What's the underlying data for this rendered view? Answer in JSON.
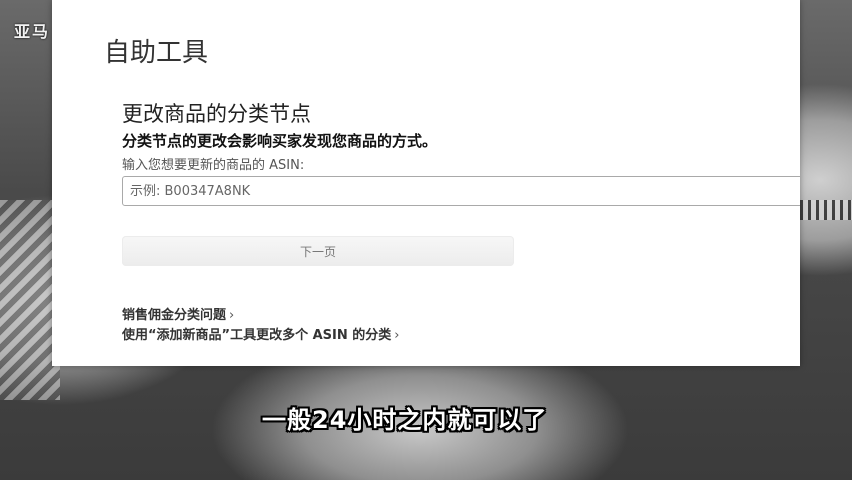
{
  "overlay": {
    "corner_label": "亚马",
    "subtitle": "一般24小时之内就可以了"
  },
  "page": {
    "title": "自助工具"
  },
  "section": {
    "title": "更改商品的分类节点",
    "description": "分类节点的更改会影响买家发现您商品的方式。",
    "asin_label": "输入您想要更新的商品的 ASIN:",
    "asin_placeholder": "示例: B00347A8NK",
    "next_button": "下一页"
  },
  "links": [
    {
      "label": "销售佣金分类问题",
      "chevron": "›"
    },
    {
      "label": "使用“添加新商品”工具更改多个 ASIN 的分类",
      "chevron": "›"
    }
  ]
}
